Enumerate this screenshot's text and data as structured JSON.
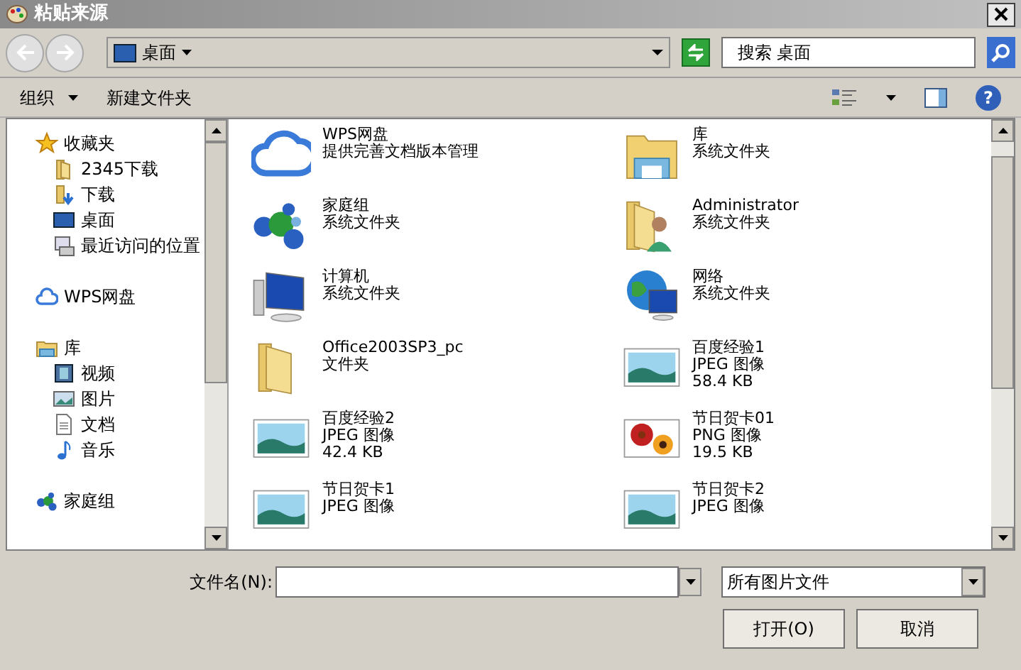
{
  "window": {
    "title": "粘贴来源"
  },
  "address": {
    "location": "桌面"
  },
  "search": {
    "placeholder": "搜索 桌面"
  },
  "toolbar": {
    "organize": "组织",
    "new_folder": "新建文件夹",
    "help": "?"
  },
  "sidebar": {
    "groups": [
      {
        "label": "收藏夹",
        "children": [
          {
            "label": "2345下载"
          },
          {
            "label": "下载"
          },
          {
            "label": "桌面"
          },
          {
            "label": "最近访问的位置"
          }
        ]
      },
      {
        "label": "WPS网盘"
      },
      {
        "label": "库",
        "children": [
          {
            "label": "视频"
          },
          {
            "label": "图片"
          },
          {
            "label": "文档"
          },
          {
            "label": "音乐"
          }
        ]
      },
      {
        "label": "家庭组"
      }
    ]
  },
  "items": [
    {
      "kind": "cloud",
      "name": "WPS网盘",
      "lines": [
        "提供完善文档版本管理"
      ]
    },
    {
      "kind": "library",
      "name": "库",
      "lines": [
        "系统文件夹"
      ]
    },
    {
      "kind": "homegroup",
      "name": "家庭组",
      "lines": [
        "系统文件夹"
      ]
    },
    {
      "kind": "user",
      "name": "Administrator",
      "lines": [
        "系统文件夹"
      ]
    },
    {
      "kind": "computer",
      "name": "计算机",
      "lines": [
        "系统文件夹"
      ]
    },
    {
      "kind": "network",
      "name": "网络",
      "lines": [
        "系统文件夹"
      ]
    },
    {
      "kind": "folder",
      "name": "Office2003SP3_pc",
      "lines": [
        "文件夹"
      ]
    },
    {
      "kind": "photo",
      "name": "百度经验1",
      "lines": [
        "JPEG 图像",
        "58.4 KB"
      ]
    },
    {
      "kind": "photo",
      "name": "百度经验2",
      "lines": [
        "JPEG 图像",
        "42.4 KB"
      ]
    },
    {
      "kind": "flower",
      "name": "节日贺卡01",
      "lines": [
        "PNG 图像",
        "19.5 KB"
      ]
    },
    {
      "kind": "photo",
      "name": "节日贺卡1",
      "lines": [
        "JPEG 图像"
      ]
    },
    {
      "kind": "photo",
      "name": "节日贺卡2",
      "lines": [
        "JPEG 图像"
      ]
    }
  ],
  "file_name": {
    "label": "文件名(N):"
  },
  "file_type": {
    "value": "所有图片文件"
  },
  "buttons": [
    "打开(O)",
    "取消"
  ]
}
